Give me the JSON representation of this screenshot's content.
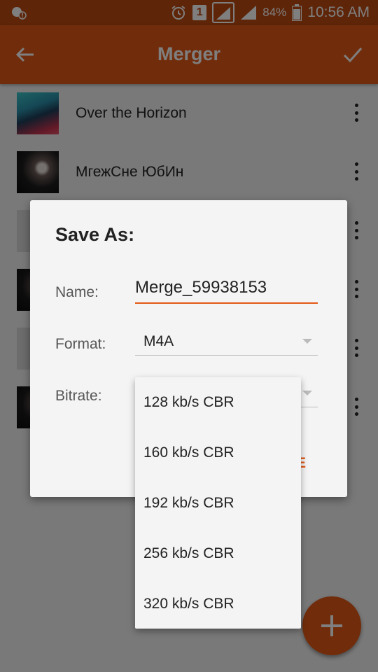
{
  "status_bar": {
    "sim_number": "1",
    "battery": "84%",
    "time": "10:56 AM"
  },
  "toolbar": {
    "title": "Merger"
  },
  "tracks": [
    {
      "title": "Over the Horizon",
      "art": "thumb-horizon"
    },
    {
      "title": "МгежСне ЮбИн",
      "art": "thumb-dark"
    },
    {
      "title": "",
      "art": "thumb-gray"
    },
    {
      "title": "",
      "art": "thumb-dark"
    },
    {
      "title": "",
      "art": "thumb-gray"
    },
    {
      "title": "",
      "art": "thumb-dark"
    }
  ],
  "dialog": {
    "title": "Save As:",
    "name_label": "Name:",
    "name_value": "Merge_59938153",
    "format_label": "Format:",
    "format_value": "M4A",
    "bitrate_label": "Bitrate:",
    "action_label": "E"
  },
  "bitrate_options": [
    "128 kb/s CBR",
    "160 kb/s CBR",
    "192 kb/s CBR",
    "256 kb/s CBR",
    "320 kb/s CBR"
  ],
  "colors": {
    "accent": "#e35a16",
    "status_bar": "#bd4a10"
  },
  "icons": {
    "status_left": "alert-location-icon",
    "alarm": "alarm-icon",
    "battery": "battery-icon",
    "back": "arrow-back-icon",
    "confirm": "check-icon",
    "overflow": "more-vert-icon",
    "fab": "add-icon"
  }
}
